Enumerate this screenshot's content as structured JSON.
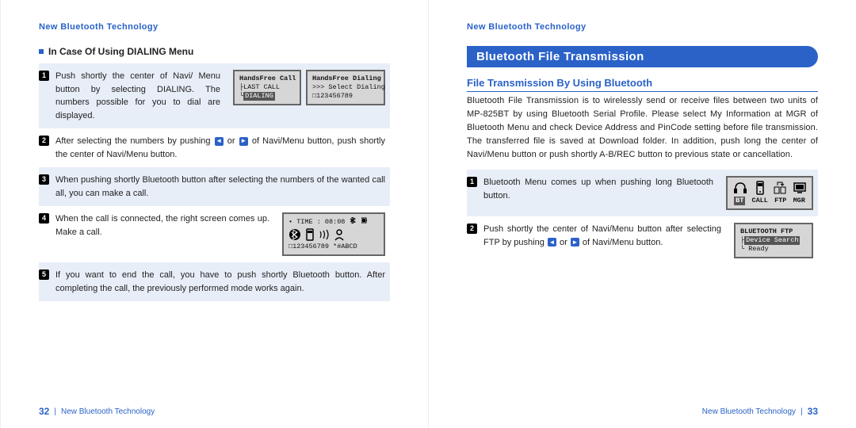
{
  "header": {
    "title": "New Bluetooth Technology"
  },
  "left": {
    "subhead": "In Case Of Using DIALING Menu",
    "steps": [
      {
        "n": "1",
        "text": "Push shortly the center of Navi/ Menu button by selecting DIALING. The numbers possible for you to dial are displayed."
      },
      {
        "n": "2",
        "text_a": "After selecting the numbers by pushing ",
        "text_b": " or ",
        "text_c": " of Navi/Menu button, push shortly the center of Navi/Menu button."
      },
      {
        "n": "3",
        "text": "When pushing shortly Bluetooth button after selecting the numbers of the wanted call all, you can make a call."
      },
      {
        "n": "4",
        "text": "When the call is connected, the right screen comes up. Make a call."
      },
      {
        "n": "5",
        "text": "If you want to end the call, you have to push shortly Bluetooth button. After completing the call, the previously performed mode works again."
      }
    ],
    "lcd1a": {
      "title": "HandsFree Call",
      "r1": "├LAST CALL",
      "r2_sel": "DIALING",
      "r2_pre": "└"
    },
    "lcd1b": {
      "title": "HandsFree Dialing",
      "r1": ">>> Select Dialing",
      "r2": "□123456789"
    },
    "lcd4": {
      "time": "• TIME : 08:08",
      "num": "□123456789 *#ABCD"
    },
    "footer_page": "32",
    "footer_text": "New Bluetooth Technology"
  },
  "right": {
    "section_bar": "Bluetooth File Transmission",
    "subhead": "File Transmission By Using Bluetooth",
    "intro": "Bluetooth File Transmission is to wirelessly send or receive files between two units of MP-825BT by using Bluetooth Serial Profile. Please select My Information at MGR of Bluetooth Menu and check Device Address and PinCode setting before file transmission. The transferred file is saved at Download folder. In addition, push long the center of Navi/Menu button or push shortly A-B/REC button to previous state or cancellation.",
    "steps": [
      {
        "n": "1",
        "text": "Bluetooth Menu comes up when pushing long Bluetooth button."
      },
      {
        "n": "2",
        "text_a": "Push shortly the center of Navi/Menu button after selecting FTP by pushing ",
        "text_b": " or ",
        "text_c": " of Navi/Menu button."
      }
    ],
    "lcd1": {
      "row2_sel": "BT",
      "row2_b": "CALL",
      "row2_c": "FTP",
      "row2_d": "MGR"
    },
    "lcd2": {
      "title": "BLUETOOTH FTP",
      "r1_sel": "Device Search",
      "r1_pre": "├",
      "r2": "└ Ready"
    },
    "footer_page": "33",
    "footer_text": "New Bluetooth Technology"
  }
}
